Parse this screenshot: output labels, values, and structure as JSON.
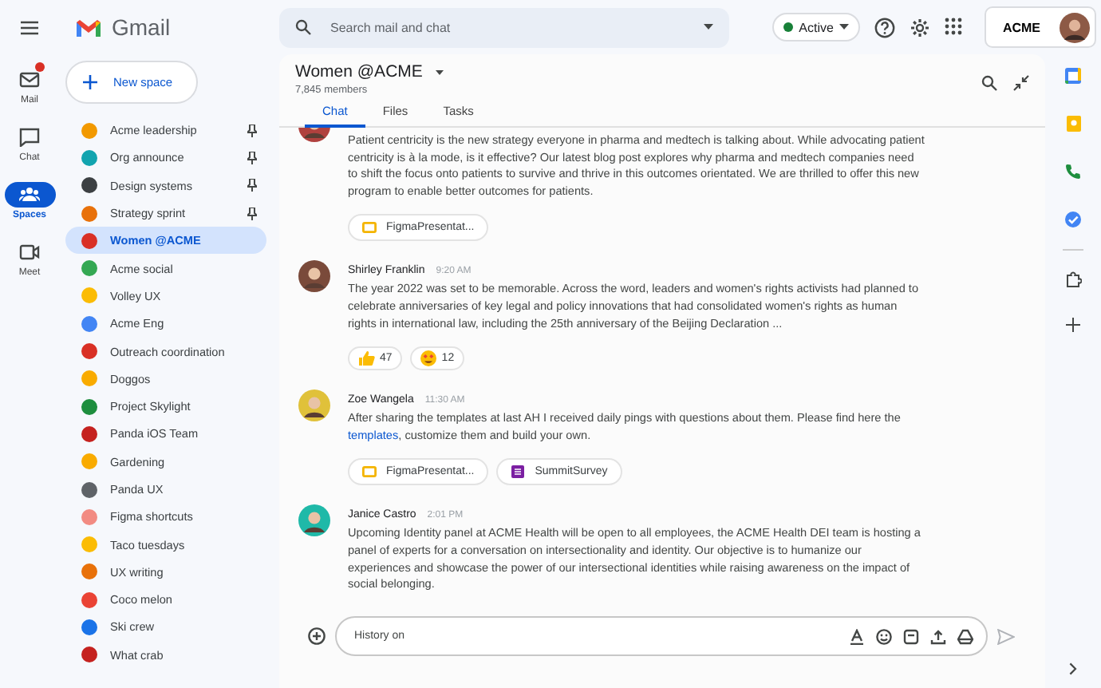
{
  "app": {
    "name": "Gmail"
  },
  "search": {
    "placeholder": "Search mail and chat"
  },
  "status": {
    "label": "Active",
    "color": "#188038"
  },
  "account": {
    "label": "ACME"
  },
  "rail": [
    {
      "label": "Mail",
      "kind": "mail",
      "badge": true,
      "selected": false
    },
    {
      "label": "Chat",
      "kind": "chat",
      "badge": false,
      "selected": false
    },
    {
      "label": "Spaces",
      "kind": "spaces",
      "badge": false,
      "selected": true
    },
    {
      "label": "Meet",
      "kind": "meet",
      "badge": false,
      "selected": false
    }
  ],
  "new_space": {
    "label": "New space"
  },
  "spaces": [
    {
      "name": "Acme leadership",
      "pinned": true,
      "selected": false,
      "color": "#f29900"
    },
    {
      "name": "Org announce",
      "pinned": true,
      "selected": false,
      "color": "#12a4af"
    },
    {
      "name": "Design systems",
      "pinned": true,
      "selected": false,
      "color": "#3c4043"
    },
    {
      "name": "Strategy sprint",
      "pinned": true,
      "selected": false,
      "color": "#e8710a"
    },
    {
      "name": "Women @ACME",
      "pinned": false,
      "selected": true,
      "color": "#d93025"
    },
    {
      "name": "Acme social",
      "pinned": false,
      "selected": false,
      "color": "#34a853"
    },
    {
      "name": "Volley UX",
      "pinned": false,
      "selected": false,
      "color": "#fbbc04"
    },
    {
      "name": "Acme Eng",
      "pinned": false,
      "selected": false,
      "color": "#4285f4"
    },
    {
      "name": "Outreach coordination",
      "pinned": false,
      "selected": false,
      "color": "#d93025"
    },
    {
      "name": "Doggos",
      "pinned": false,
      "selected": false,
      "color": "#f9ab00"
    },
    {
      "name": "Project Skylight",
      "pinned": false,
      "selected": false,
      "color": "#1e8e3e"
    },
    {
      "name": "Panda iOS Team",
      "pinned": false,
      "selected": false,
      "color": "#c5221f"
    },
    {
      "name": "Gardening",
      "pinned": false,
      "selected": false,
      "color": "#f9ab00"
    },
    {
      "name": "Panda UX",
      "pinned": false,
      "selected": false,
      "color": "#5f6368"
    },
    {
      "name": "Figma shortcuts",
      "pinned": false,
      "selected": false,
      "color": "#f28b82"
    },
    {
      "name": "Taco tuesdays",
      "pinned": false,
      "selected": false,
      "color": "#fbbc04"
    },
    {
      "name": "UX writing",
      "pinned": false,
      "selected": false,
      "color": "#e8710a"
    },
    {
      "name": "Coco melon",
      "pinned": false,
      "selected": false,
      "color": "#ea4335"
    },
    {
      "name": "Ski crew",
      "pinned": false,
      "selected": false,
      "color": "#1a73e8"
    },
    {
      "name": "What crab",
      "pinned": false,
      "selected": false,
      "color": "#c5221f"
    }
  ],
  "space_header": {
    "title": "Women @ACME",
    "members": "7,845 members"
  },
  "tabs": [
    {
      "label": "Chat",
      "selected": true
    },
    {
      "label": "Files",
      "selected": false
    },
    {
      "label": "Tasks",
      "selected": false
    }
  ],
  "messages": [
    {
      "text": [
        {
          "text": "Patient centricity is the new strategy everyone in pharma and medtech is talking about. While advocating patient centricity is à la mode, is it effective? Our latest blog post explores why pharma and medtech companies need to shift the focus onto patients to survive and thrive in this outcomes orientated. We are thrilled to offer this new program to enable better outcomes for patients."
        }
      ],
      "attachments": [
        {
          "name": "FigmaPresentat...",
          "kind": "slides"
        }
      ]
    },
    {
      "author": "Shirley Franklin",
      "time": "9:20 AM",
      "text": [
        {
          "text": "The year 2022 was set to be memorable. Across the word, leaders and women's rights activists had planned to celebrate anniversaries of key legal and policy innovations that had consolidated women's rights as human rights in international law, including the 25th anniversary of the Beijing Declaration  ..."
        }
      ],
      "reactions": [
        {
          "kind": "thumbs_up",
          "count": "47"
        },
        {
          "kind": "heart_eyes",
          "count": "12"
        }
      ]
    },
    {
      "author": "Zoe Wangela",
      "time": "11:30 AM",
      "text": [
        {
          "text": "After sharing the templates at last AH I received daily pings with questions about them. Please find here the "
        },
        {
          "link": "templates"
        },
        {
          "text": ", customize them and build your own."
        }
      ],
      "attachments": [
        {
          "name": "FigmaPresentat...",
          "kind": "slides"
        },
        {
          "name": "SummitSurvey",
          "kind": "form"
        }
      ]
    },
    {
      "author": "Janice Castro",
      "time": "2:01 PM",
      "text": [
        {
          "text": "Upcoming Identity panel at ACME Health will be open to all employees, the ACME Health DEI team is hosting a panel of experts for a conversation on intersectionality and identity. Our objective is to humanize our experiences and showcase the power of our intersectional identities while raising awareness on the impact of social belonging."
        }
      ]
    }
  ],
  "composer": {
    "placeholder": "History on"
  }
}
